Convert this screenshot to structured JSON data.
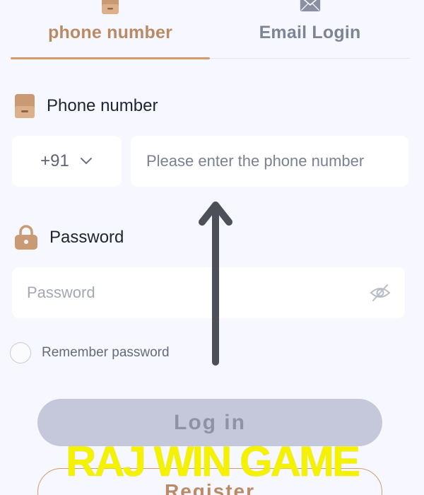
{
  "tabs": {
    "phone": {
      "label": "phone number",
      "icon": "phone-icon"
    },
    "email": {
      "label": "Email Login",
      "icon": "mail-icon"
    }
  },
  "phone_section": {
    "label": "Phone number",
    "icon": "phone-icon",
    "country_code": "+91",
    "placeholder": "Please enter the phone number",
    "value": ""
  },
  "password_section": {
    "label": "Password",
    "icon": "lock-icon",
    "placeholder": "Password",
    "value": "",
    "toggle_icon": "eye-off-icon"
  },
  "remember": {
    "label": "Remember password",
    "checked": false
  },
  "buttons": {
    "login": "Log in",
    "register": "Register"
  },
  "overlay": {
    "watermark": "RAJ WIN GAME",
    "arrow_icon": "arrow-up-icon"
  },
  "colors": {
    "accent": "#d49a6a",
    "accent_text": "#b98a64",
    "background": "#f7f8ff",
    "login_bg": "#c5c8da",
    "watermark": "#f5f200"
  }
}
